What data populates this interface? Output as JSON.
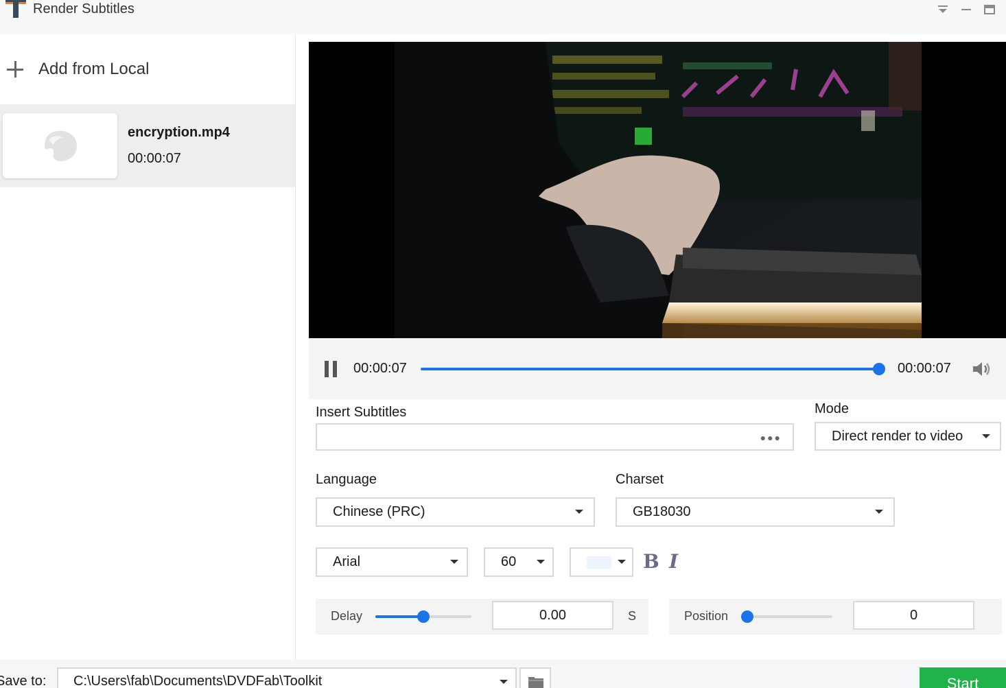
{
  "window": {
    "title": "Render Subtitles",
    "controls": [
      "menu-icon",
      "minimize-icon",
      "maximize-icon"
    ]
  },
  "sidebar": {
    "add_label": "Add from Local",
    "files": [
      {
        "name": "encryption.mp4",
        "duration": "00:00:07"
      }
    ]
  },
  "player": {
    "current_time": "00:00:07",
    "total_time": "00:00:07",
    "progress": 1.0,
    "play_state_icon": "pause-icon",
    "volume_icon": "speaker-icon"
  },
  "subtitles": {
    "insert_label": "Insert Subtitles",
    "insert_value": "",
    "mode_label": "Mode",
    "mode_value": "Direct render to video",
    "language_label": "Language",
    "language_value": "Chinese (PRC)",
    "charset_label": "Charset",
    "charset_value": "GB18030",
    "font_value": "Arial",
    "size_value": "60",
    "color_value": "#eef4ff",
    "bold_label": "B",
    "italic_label": "I",
    "delay_label": "Delay",
    "delay_value": "0.00",
    "delay_unit": "S",
    "delay_slider_fraction": 0.5,
    "position_label": "Position",
    "position_value": "0",
    "position_slider_fraction": 0.0
  },
  "footer": {
    "save_label": "Save to:",
    "save_path": "C:\\Users\\fab\\Documents\\DVDFab\\Toolkit",
    "start_label": "Start"
  },
  "colors": {
    "accent": "#1a73e8",
    "start": "#1fb34a"
  }
}
